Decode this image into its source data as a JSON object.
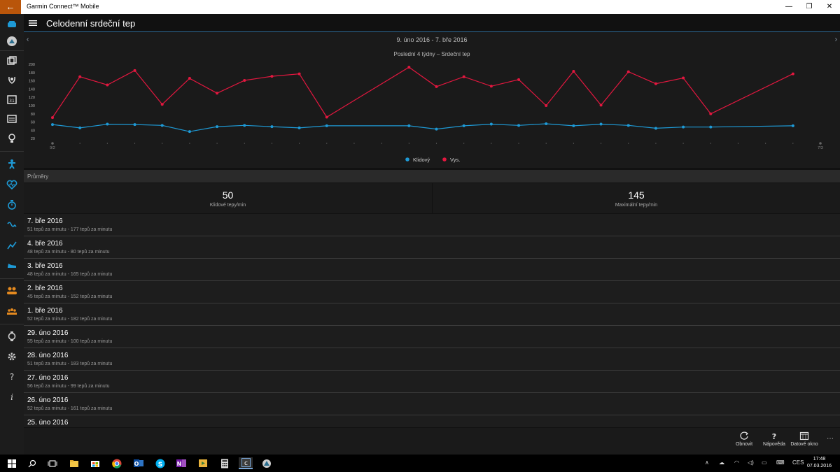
{
  "window": {
    "title": "Garmin Connect™ Mobile",
    "back_icon": "arrow-left-icon",
    "minimize_label": "—",
    "maximize_label": "❐",
    "close_label": "✕"
  },
  "header": {
    "title": "Celodenní srdeční tep"
  },
  "chart": {
    "date_range": "9. úno 2016 - 7. bře 2016",
    "prev_label": "‹",
    "next_label": "›"
  },
  "chart_data": {
    "type": "line",
    "title": "Poslední 4 týdny – Srdeční tep",
    "ylim": [
      0,
      200
    ],
    "yticks": [
      20,
      40,
      60,
      80,
      100,
      120,
      140,
      160,
      180,
      200
    ],
    "x_labels": {
      "first": "9/2",
      "last": "7/3"
    },
    "x_days": 28,
    "grid": false,
    "legend": "bottom-center",
    "series": [
      {
        "name": "Klidový",
        "color": "#1e9ad6",
        "points": [
          [
            0,
            54
          ],
          [
            1,
            46
          ],
          [
            2,
            55
          ],
          [
            3,
            54
          ],
          [
            4,
            52
          ],
          [
            5,
            37
          ],
          [
            6,
            49
          ],
          [
            7,
            52
          ],
          [
            8,
            49
          ],
          [
            9,
            46
          ],
          [
            10,
            51
          ],
          [
            13,
            51
          ],
          [
            14,
            43
          ],
          [
            15,
            51
          ],
          [
            16,
            55
          ],
          [
            17,
            52
          ],
          [
            18,
            56
          ],
          [
            19,
            51
          ],
          [
            20,
            55
          ],
          [
            21,
            52
          ],
          [
            22,
            45
          ],
          [
            23,
            48
          ],
          [
            24,
            48
          ],
          [
            27,
            51
          ]
        ]
      },
      {
        "name": "Vys.",
        "color": "#e3173f",
        "points": [
          [
            0,
            71
          ],
          [
            1,
            170
          ],
          [
            2,
            150
          ],
          [
            3,
            185
          ],
          [
            4,
            103
          ],
          [
            5,
            166
          ],
          [
            6,
            130
          ],
          [
            7,
            161
          ],
          [
            8,
            171
          ],
          [
            9,
            177
          ],
          [
            10,
            72
          ],
          [
            13,
            193
          ],
          [
            14,
            146
          ],
          [
            15,
            170
          ],
          [
            16,
            147
          ],
          [
            17,
            163
          ],
          [
            18,
            100
          ],
          [
            19,
            183
          ],
          [
            20,
            101
          ],
          [
            21,
            182
          ],
          [
            22,
            153
          ],
          [
            23,
            167
          ],
          [
            24,
            80
          ],
          [
            27,
            177
          ]
        ]
      }
    ]
  },
  "averages": {
    "heading": "Průměry",
    "resting": {
      "value": "50",
      "label": "Klidové tepy/min"
    },
    "max": {
      "value": "145",
      "label": "Maximální tepy/min"
    }
  },
  "days": [
    {
      "date": "7. bře 2016",
      "range": "51 tepů za minutu - 177 tepů za minutu"
    },
    {
      "date": "4. bře 2016",
      "range": "48 tepů za minutu - 80 tepů za minutu"
    },
    {
      "date": "3. bře 2016",
      "range": "48 tepů za minutu - 165 tepů za minutu"
    },
    {
      "date": "2. bře 2016",
      "range": "45 tepů za minutu - 152 tepů za minutu"
    },
    {
      "date": "1. bře 2016",
      "range": "52 tepů za minutu - 182 tepů za minutu"
    },
    {
      "date": "29. úno 2016",
      "range": "55 tepů za minutu - 100 tepů za minutu"
    },
    {
      "date": "28. úno 2016",
      "range": "51 tepů za minutu - 183 tepů za minutu"
    },
    {
      "date": "27. úno 2016",
      "range": "56 tepů za minutu - 99 tepů za minutu"
    },
    {
      "date": "26. úno 2016",
      "range": "52 tepů za minutu - 161 tepů za minutu"
    },
    {
      "date": "25. úno 2016",
      "range": ""
    }
  ],
  "commands": {
    "refresh": "Obnovit",
    "help": "Nápověda",
    "data_window": "Datové okno",
    "more": "⋯"
  },
  "taskbar": {
    "time": "17:48",
    "date": "07.03.2016",
    "language": "CES"
  },
  "colors": {
    "accent": "#1e9ad6",
    "max_series": "#e3173f",
    "back_button": "#b9550a"
  }
}
